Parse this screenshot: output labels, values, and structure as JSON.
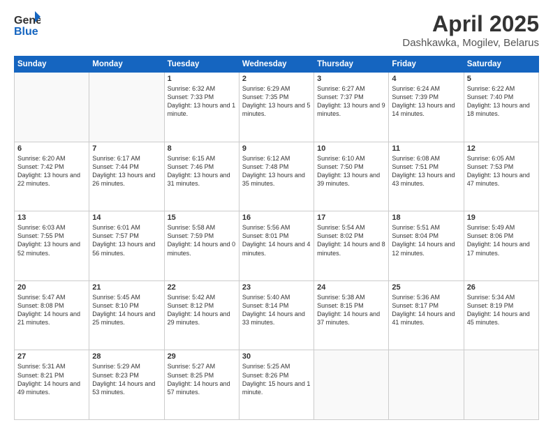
{
  "header": {
    "logo_general": "General",
    "logo_blue": "Blue",
    "month": "April 2025",
    "location": "Dashkawka, Mogilev, Belarus"
  },
  "days_of_week": [
    "Sunday",
    "Monday",
    "Tuesday",
    "Wednesday",
    "Thursday",
    "Friday",
    "Saturday"
  ],
  "weeks": [
    [
      {
        "day": "",
        "info": ""
      },
      {
        "day": "",
        "info": ""
      },
      {
        "day": "1",
        "info": "Sunrise: 6:32 AM\nSunset: 7:33 PM\nDaylight: 13 hours and 1 minute."
      },
      {
        "day": "2",
        "info": "Sunrise: 6:29 AM\nSunset: 7:35 PM\nDaylight: 13 hours and 5 minutes."
      },
      {
        "day": "3",
        "info": "Sunrise: 6:27 AM\nSunset: 7:37 PM\nDaylight: 13 hours and 9 minutes."
      },
      {
        "day": "4",
        "info": "Sunrise: 6:24 AM\nSunset: 7:39 PM\nDaylight: 13 hours and 14 minutes."
      },
      {
        "day": "5",
        "info": "Sunrise: 6:22 AM\nSunset: 7:40 PM\nDaylight: 13 hours and 18 minutes."
      }
    ],
    [
      {
        "day": "6",
        "info": "Sunrise: 6:20 AM\nSunset: 7:42 PM\nDaylight: 13 hours and 22 minutes."
      },
      {
        "day": "7",
        "info": "Sunrise: 6:17 AM\nSunset: 7:44 PM\nDaylight: 13 hours and 26 minutes."
      },
      {
        "day": "8",
        "info": "Sunrise: 6:15 AM\nSunset: 7:46 PM\nDaylight: 13 hours and 31 minutes."
      },
      {
        "day": "9",
        "info": "Sunrise: 6:12 AM\nSunset: 7:48 PM\nDaylight: 13 hours and 35 minutes."
      },
      {
        "day": "10",
        "info": "Sunrise: 6:10 AM\nSunset: 7:50 PM\nDaylight: 13 hours and 39 minutes."
      },
      {
        "day": "11",
        "info": "Sunrise: 6:08 AM\nSunset: 7:51 PM\nDaylight: 13 hours and 43 minutes."
      },
      {
        "day": "12",
        "info": "Sunrise: 6:05 AM\nSunset: 7:53 PM\nDaylight: 13 hours and 47 minutes."
      }
    ],
    [
      {
        "day": "13",
        "info": "Sunrise: 6:03 AM\nSunset: 7:55 PM\nDaylight: 13 hours and 52 minutes."
      },
      {
        "day": "14",
        "info": "Sunrise: 6:01 AM\nSunset: 7:57 PM\nDaylight: 13 hours and 56 minutes."
      },
      {
        "day": "15",
        "info": "Sunrise: 5:58 AM\nSunset: 7:59 PM\nDaylight: 14 hours and 0 minutes."
      },
      {
        "day": "16",
        "info": "Sunrise: 5:56 AM\nSunset: 8:01 PM\nDaylight: 14 hours and 4 minutes."
      },
      {
        "day": "17",
        "info": "Sunrise: 5:54 AM\nSunset: 8:02 PM\nDaylight: 14 hours and 8 minutes."
      },
      {
        "day": "18",
        "info": "Sunrise: 5:51 AM\nSunset: 8:04 PM\nDaylight: 14 hours and 12 minutes."
      },
      {
        "day": "19",
        "info": "Sunrise: 5:49 AM\nSunset: 8:06 PM\nDaylight: 14 hours and 17 minutes."
      }
    ],
    [
      {
        "day": "20",
        "info": "Sunrise: 5:47 AM\nSunset: 8:08 PM\nDaylight: 14 hours and 21 minutes."
      },
      {
        "day": "21",
        "info": "Sunrise: 5:45 AM\nSunset: 8:10 PM\nDaylight: 14 hours and 25 minutes."
      },
      {
        "day": "22",
        "info": "Sunrise: 5:42 AM\nSunset: 8:12 PM\nDaylight: 14 hours and 29 minutes."
      },
      {
        "day": "23",
        "info": "Sunrise: 5:40 AM\nSunset: 8:14 PM\nDaylight: 14 hours and 33 minutes."
      },
      {
        "day": "24",
        "info": "Sunrise: 5:38 AM\nSunset: 8:15 PM\nDaylight: 14 hours and 37 minutes."
      },
      {
        "day": "25",
        "info": "Sunrise: 5:36 AM\nSunset: 8:17 PM\nDaylight: 14 hours and 41 minutes."
      },
      {
        "day": "26",
        "info": "Sunrise: 5:34 AM\nSunset: 8:19 PM\nDaylight: 14 hours and 45 minutes."
      }
    ],
    [
      {
        "day": "27",
        "info": "Sunrise: 5:31 AM\nSunset: 8:21 PM\nDaylight: 14 hours and 49 minutes."
      },
      {
        "day": "28",
        "info": "Sunrise: 5:29 AM\nSunset: 8:23 PM\nDaylight: 14 hours and 53 minutes."
      },
      {
        "day": "29",
        "info": "Sunrise: 5:27 AM\nSunset: 8:25 PM\nDaylight: 14 hours and 57 minutes."
      },
      {
        "day": "30",
        "info": "Sunrise: 5:25 AM\nSunset: 8:26 PM\nDaylight: 15 hours and 1 minute."
      },
      {
        "day": "",
        "info": ""
      },
      {
        "day": "",
        "info": ""
      },
      {
        "day": "",
        "info": ""
      }
    ]
  ]
}
